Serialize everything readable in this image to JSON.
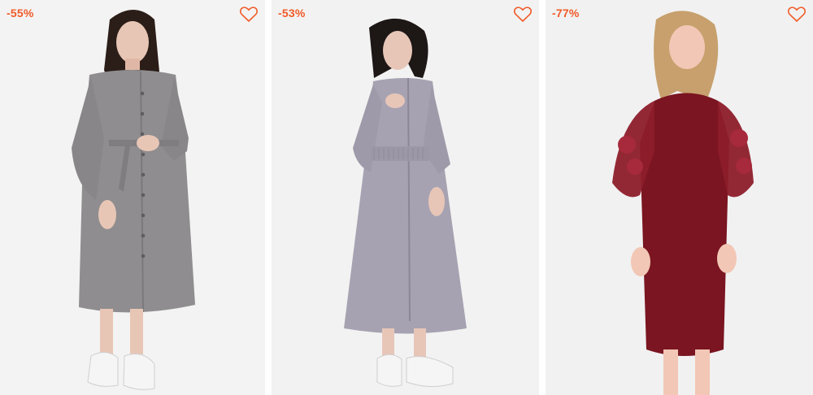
{
  "products": [
    {
      "discount": "-55%",
      "favorite_icon": "heart-outline-icon",
      "dress_color": "#8f8d8f",
      "accent": "#f05a28"
    },
    {
      "discount": "-53%",
      "favorite_icon": "heart-outline-icon",
      "dress_color": "#a7a2b1",
      "accent": "#f05a28"
    },
    {
      "discount": "-77%",
      "favorite_icon": "heart-outline-icon",
      "dress_color": "#7a1521",
      "accent": "#f05a28"
    }
  ]
}
